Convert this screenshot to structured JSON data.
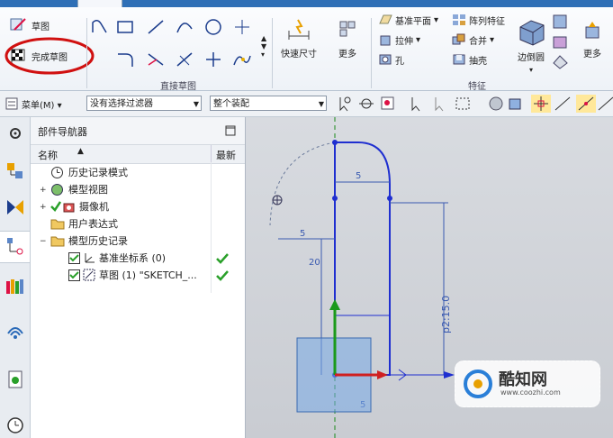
{
  "ribbon": {
    "tabs": [
      "",
      "",
      "",
      "",
      "",
      "",
      "",
      "",
      ""
    ],
    "sketch_btn": "草图",
    "finish_sketch_btn": "完成草图",
    "direct_sketch_group": "直接草图",
    "quick_dim_btn": "快速尺寸",
    "more_btn_1": "更多",
    "datum_plane_btn": "基准平面",
    "array_feature_btn": "阵列特征",
    "extrude_btn": "拉伸",
    "combine_btn": "合并",
    "hole_btn": "孔",
    "shell_btn": "抽壳",
    "edge_blend_btn": "边倒圆",
    "more_btn_2": "更多",
    "feature_group": "特征"
  },
  "toolbar": {
    "menu_label": "菜单(M)",
    "filter_value": "没有选择过滤器",
    "assembly_value": "整个装配"
  },
  "navigator": {
    "title": "部件导航器",
    "col_name": "名称",
    "col_latest": "最新",
    "rows": [
      {
        "label": "历史记录模式"
      },
      {
        "label": "模型视图"
      },
      {
        "label": "摄像机"
      },
      {
        "label": "用户表达式"
      },
      {
        "label": "模型历史记录"
      },
      {
        "label": "基准坐标系 (0)"
      },
      {
        "label": "草图 (1) \"SKETCH_..."
      }
    ]
  },
  "sketch": {
    "dim_top": "5",
    "dim_left": "5",
    "dim_vertical": "20",
    "dim_right": "p2:15.0",
    "dim_bottom": "5"
  },
  "watermark": {
    "text": "酷知网",
    "url": "www.coozhi.com"
  },
  "colors": {
    "accent": "#2f6fb6",
    "sketch_line": "#1f2fd0",
    "check": "#2aa02a",
    "highlight_circle": "#d01010"
  }
}
